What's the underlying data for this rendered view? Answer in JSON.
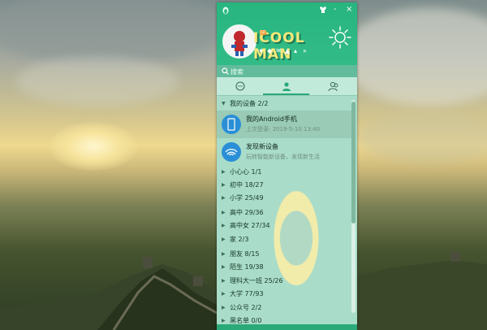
{
  "window": {
    "controls": [
      "-",
      "×"
    ]
  },
  "profile": {
    "nickname": "ICOOL MAN",
    "level": "LV",
    "status_arrow": "»"
  },
  "search": {
    "placeholder": "搜索"
  },
  "tabs": [
    {
      "name": "messages",
      "icon": "chat-icon"
    },
    {
      "name": "contacts",
      "icon": "person-icon",
      "active": true
    },
    {
      "name": "groups",
      "icon": "group-icon"
    }
  ],
  "my_devices": {
    "label": "我的设备 2/2"
  },
  "devices": [
    {
      "name": "我的Android手机",
      "sub": "上次登录: 2019-5-10 13:40",
      "icon": "phone-icon",
      "selected": true
    },
    {
      "name": "发现新设备",
      "sub": "玩转智能新设备，发现新生活",
      "icon": "wifi-icon",
      "selected": false
    }
  ],
  "groups": [
    {
      "label": "小心心 1/1"
    },
    {
      "label": "初中 18/27"
    },
    {
      "label": "小学 25/49"
    },
    {
      "label": "高中 29/36"
    },
    {
      "label": "高中女 27/34"
    },
    {
      "label": "家 2/3"
    },
    {
      "label": "朋友 8/15"
    },
    {
      "label": "陌生 19/38"
    },
    {
      "label": "理科大一班 25/26"
    },
    {
      "label": "大学 77/93"
    },
    {
      "label": "公众号 2/2"
    },
    {
      "label": "黑名单 0/0"
    }
  ],
  "colors": {
    "header": "#28b57f",
    "panel": "#a9dcc9",
    "accent": "#2aa979"
  }
}
